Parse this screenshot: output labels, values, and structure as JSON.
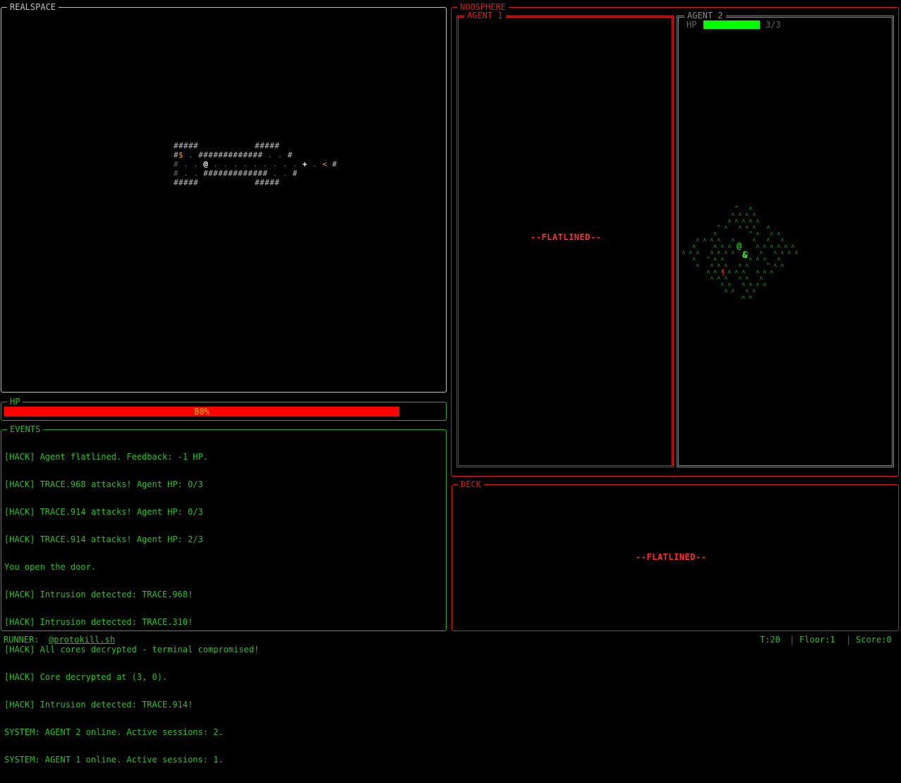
{
  "realspace": {
    "title": "REALSPACE",
    "map": {
      "row1a": "#####",
      "row1b": "#####",
      "row2_hash": "#",
      "row2_gold": "$",
      "row2_dots1": " . ",
      "row2_walls": "#############",
      "row2_dots2": " . . ",
      "row2_end": "#",
      "row3_start": "# . . ",
      "row3_player": "@",
      "row3_dots": " . . . . . . . . . ",
      "row3_door": "+",
      "row3_dot": " . ",
      "row3_stairs": "<",
      "row3_end": " #",
      "row4_start": "# . . ",
      "row4_walls": "#############",
      "row4_dots": " . . ",
      "row4_end": "#",
      "row5a": "#####",
      "row5b": "#####"
    }
  },
  "hp": {
    "title": "HP",
    "value": 0.8,
    "label": "80%"
  },
  "events": {
    "title": "EVENTS",
    "lines": [
      "[HACK] Agent flatlined. Feedback: -1 HP.",
      "[HACK] TRACE.968 attacks! Agent HP: 0/3",
      "[HACK] TRACE.914 attacks! Agent HP: 0/3",
      "[HACK] TRACE.914 attacks! Agent HP: 2/3",
      "You open the door.",
      "[HACK] Intrusion detected: TRACE.968!",
      "[HACK] Intrusion detected: TRACE.310!",
      "[HACK] All cores decrypted - terminal compromised!",
      "[HACK] Core decrypted at (3, 0).",
      "[HACK] Intrusion detected: TRACE.914!",
      "SYSTEM: AGENT 2 online. Active sessions: 2.",
      "SYSTEM: AGENT 1 online. Active sessions: 1."
    ]
  },
  "noosphere": {
    "title": "NOOSPHERE",
    "agent1": {
      "title": "AGENT 1",
      "status": "--FLATLINED--"
    },
    "agent2": {
      "title": "AGENT 2",
      "hp_label": "HP",
      "hp_value": 1.0,
      "hp_text": "3/3",
      "avatar": "@",
      "companion": "&",
      "item": "!"
    }
  },
  "deck": {
    "title": "DECK",
    "status": "--FLATLINED--"
  },
  "statusbar": {
    "runner_label": "RUNNER:",
    "runner_name": "@protokill.sh",
    "turn": "T:20",
    "floor": "Floor:1",
    "score": "Score:0",
    "sep": "|"
  },
  "colors": {
    "hp_fill": "#ff0000",
    "agent_hp_fill": "#00ff00",
    "terminal_green": "#22c322",
    "alert_red": "#e01818"
  }
}
